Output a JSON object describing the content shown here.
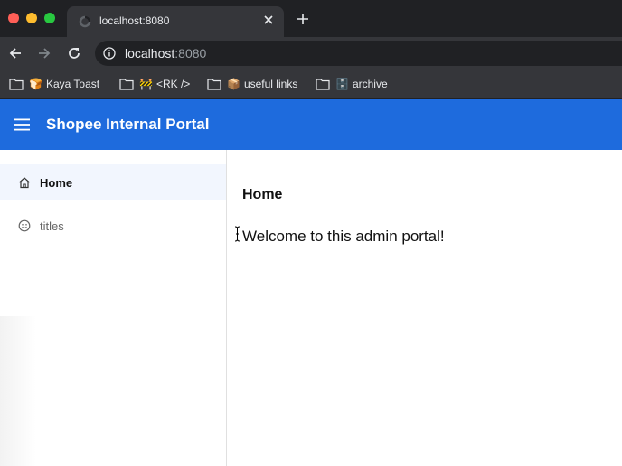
{
  "browser": {
    "tab_title": "localhost:8080",
    "url_host": "localhost",
    "url_port": ":8080",
    "bookmarks": [
      {
        "emoji": "🍞",
        "label": "Kaya Toast"
      },
      {
        "emoji": "🚧",
        "label": "<RK />"
      },
      {
        "emoji": "📦",
        "label": "useful links"
      },
      {
        "emoji": "🗄️",
        "label": "archive"
      }
    ]
  },
  "app": {
    "title": "Shopee Internal Portal",
    "brand_color": "#1e6bdd",
    "nav": [
      {
        "label": "Home",
        "icon": "home-icon",
        "active": true
      },
      {
        "label": "titles",
        "icon": "smile-icon",
        "active": false
      }
    ],
    "content": {
      "heading": "Home",
      "text": "Welcome to this admin portal!"
    }
  }
}
